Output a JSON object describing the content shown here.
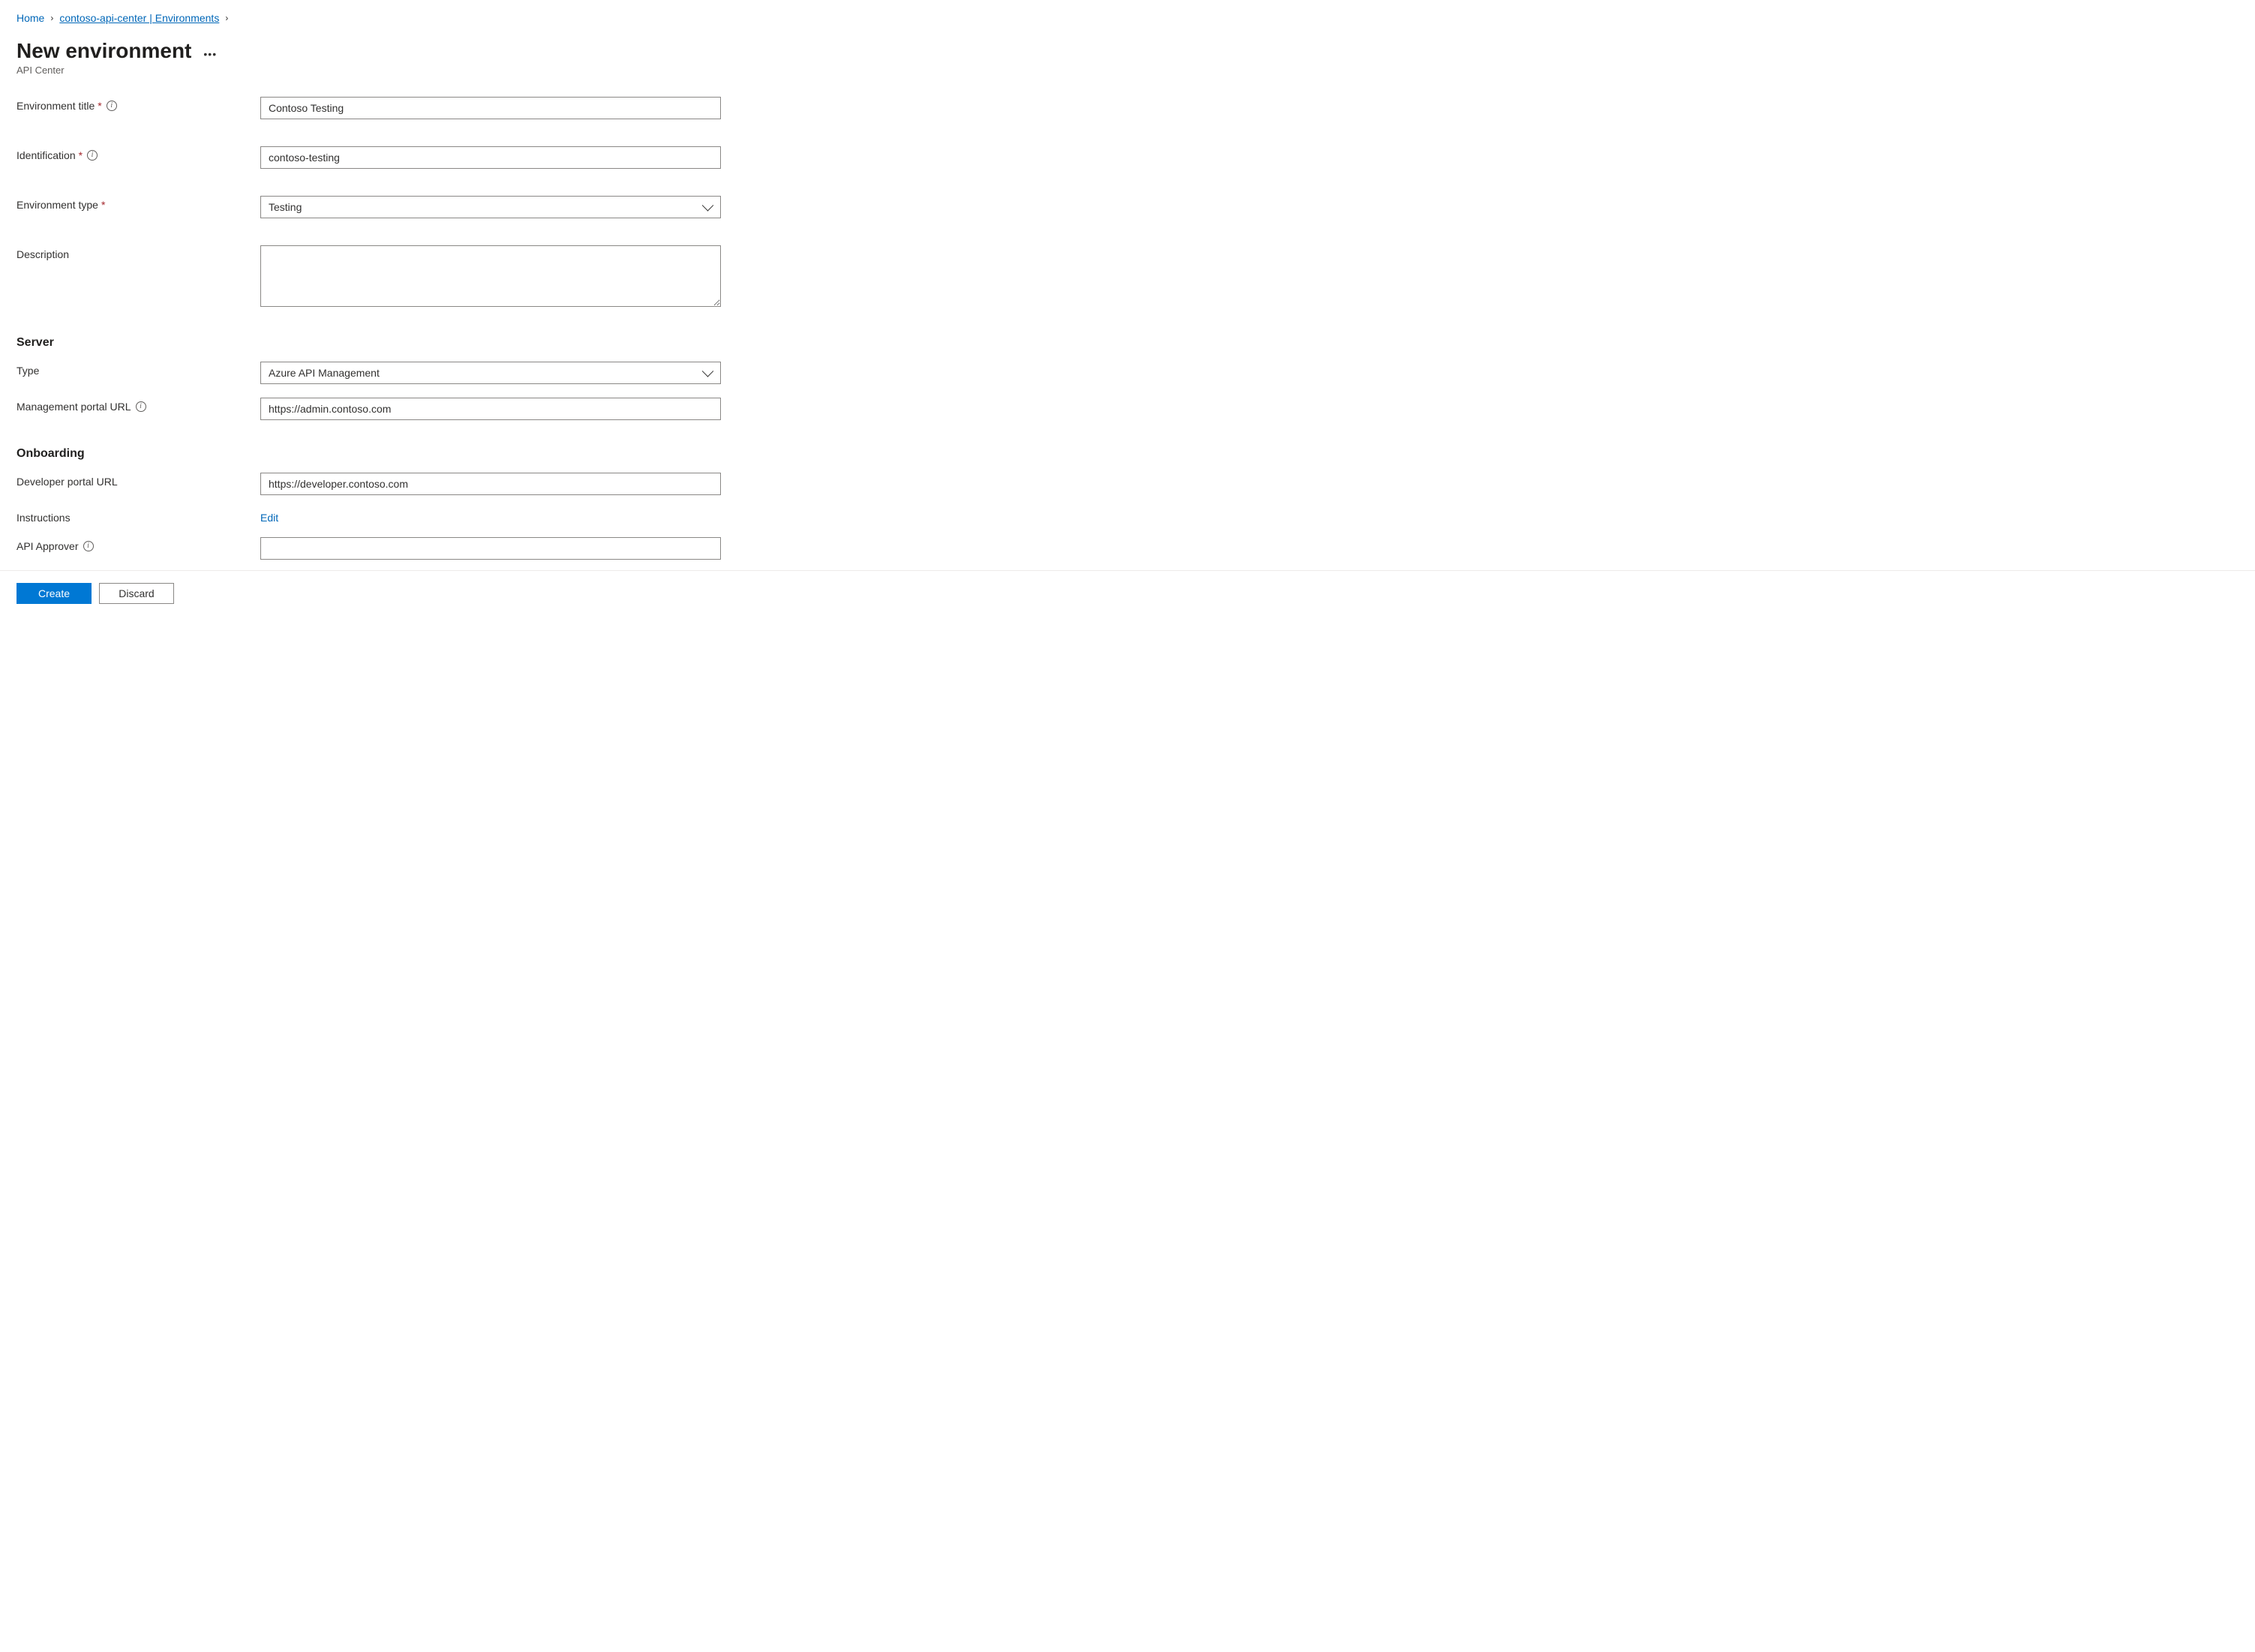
{
  "breadcrumb": {
    "home": "Home",
    "center": "contoso-api-center | Environments"
  },
  "header": {
    "title": "New environment",
    "subtitle": "API Center"
  },
  "fields": {
    "env_title": {
      "label": "Environment title",
      "value": "Contoso Testing"
    },
    "identification": {
      "label": "Identification",
      "value": "contoso-testing"
    },
    "env_type": {
      "label": "Environment type",
      "value": "Testing"
    },
    "description": {
      "label": "Description",
      "value": ""
    }
  },
  "server": {
    "heading": "Server",
    "type": {
      "label": "Type",
      "value": "Azure API Management"
    },
    "mgmt_url": {
      "label": "Management portal URL",
      "value": "https://admin.contoso.com"
    }
  },
  "onboarding": {
    "heading": "Onboarding",
    "dev_url": {
      "label": "Developer portal URL",
      "value": "https://developer.contoso.com"
    },
    "instructions": {
      "label": "Instructions",
      "action": "Edit"
    },
    "approver": {
      "label": "API Approver",
      "value": ""
    }
  },
  "footer": {
    "create": "Create",
    "discard": "Discard"
  }
}
